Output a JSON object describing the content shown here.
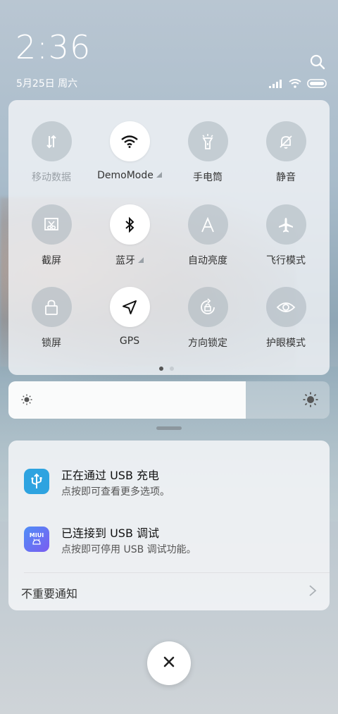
{
  "status": {
    "time": "2:36",
    "date": "5月25日 周六"
  },
  "quick_settings": {
    "tiles": [
      {
        "label": "移动数据",
        "icon": "mobile-data-icon",
        "active": false,
        "dim": true
      },
      {
        "label": "DemoMode",
        "icon": "wifi-icon",
        "active": true,
        "expandable": true
      },
      {
        "label": "手电筒",
        "icon": "flashlight-icon",
        "active": false
      },
      {
        "label": "静音",
        "icon": "mute-icon",
        "active": false
      },
      {
        "label": "截屏",
        "icon": "screenshot-icon",
        "active": false
      },
      {
        "label": "蓝牙",
        "icon": "bluetooth-icon",
        "active": true,
        "expandable": true
      },
      {
        "label": "自动亮度",
        "icon": "auto-brightness-icon",
        "active": false
      },
      {
        "label": "飞行模式",
        "icon": "airplane-icon",
        "active": false
      },
      {
        "label": "锁屏",
        "icon": "lock-icon",
        "active": false
      },
      {
        "label": "GPS",
        "icon": "location-arrow-icon",
        "active": true
      },
      {
        "label": "方向锁定",
        "icon": "rotation-lock-icon",
        "active": false
      },
      {
        "label": "护眼模式",
        "icon": "eye-icon",
        "active": false
      }
    ],
    "page_count": 2,
    "current_page": 1
  },
  "brightness": {
    "level": 0.74
  },
  "notifications": [
    {
      "title": "正在通过 USB 充电",
      "desc": "点按即可查看更多选项。",
      "icon": "usb-icon"
    },
    {
      "title": "已连接到 USB 调试",
      "desc": "点按即可停用 USB 调试功能。",
      "icon": "miui-icon",
      "icon_text": "MIUI"
    }
  ],
  "unimportant_label": "不重要通知",
  "colors": {
    "usb_icon_bg": "#2ea3e0",
    "miui_icon_bg": "#5b7df5"
  }
}
